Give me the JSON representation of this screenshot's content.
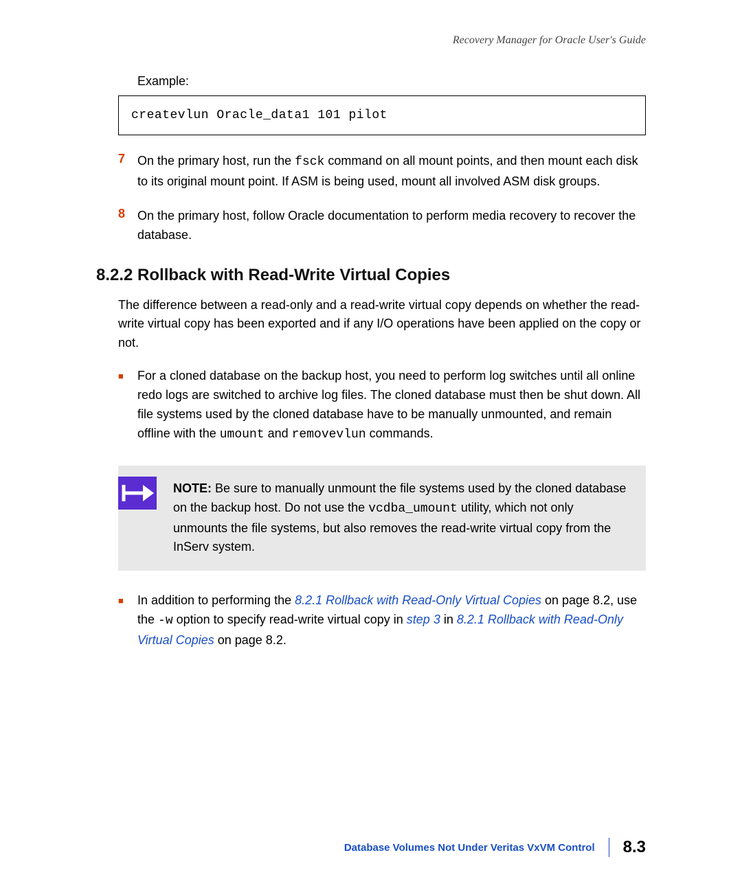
{
  "header": "Recovery Manager for Oracle User's Guide",
  "example_label": "Example:",
  "code_example": "createvlun Oracle_data1 101 pilot",
  "step7": {
    "num": "7",
    "pre": "On the primary host, run the ",
    "code": "fsck",
    "post": " command on all mount points, and then mount each disk to its original mount point. If ASM is being used, mount all involved ASM disk groups."
  },
  "step8": {
    "num": "8",
    "text": "On the primary host, follow Oracle documentation to perform media recovery to recover the database."
  },
  "section_heading": "8.2.2 Rollback with Read-Write Virtual Copies",
  "intro_para": "The difference between a read-only and a read-write virtual copy depends on whether the read-write virtual copy has been exported and if any I/O operations have been applied on the copy or not.",
  "bullet1": {
    "pre": "For a cloned database on the backup host, you need to perform log switches until all online redo logs are switched to archive log files. The cloned database must then be shut down. All file systems used by the cloned database have to be manually unmounted, and remain offline with the ",
    "code1": "umount",
    "mid": " and ",
    "code2": "removevlun",
    "post": " commands."
  },
  "note": {
    "label": "NOTE:",
    "pre": " Be sure to manually unmount the file systems used by the cloned database on the backup host. Do not use the ",
    "code": "vcdba_umount",
    "post": " utility, which not only unmounts the file systems, but also removes the read-write virtual copy from the InServ system."
  },
  "bullet2": {
    "pre": "In addition to performing the ",
    "link1": "8.2.1 Rollback with Read-Only Virtual Copies",
    "mid1": " on page 8.2, use the ",
    "code": " -w",
    "mid2": " option to specify read-write virtual copy in ",
    "link_step": "step 3",
    "mid3": " in ",
    "link2": "8.2.1 Rollback with Read-Only Virtual Copies",
    "post": " on page 8.2."
  },
  "footer": {
    "chapter": "Database Volumes Not Under Veritas VxVM Control",
    "page": "8.3"
  }
}
